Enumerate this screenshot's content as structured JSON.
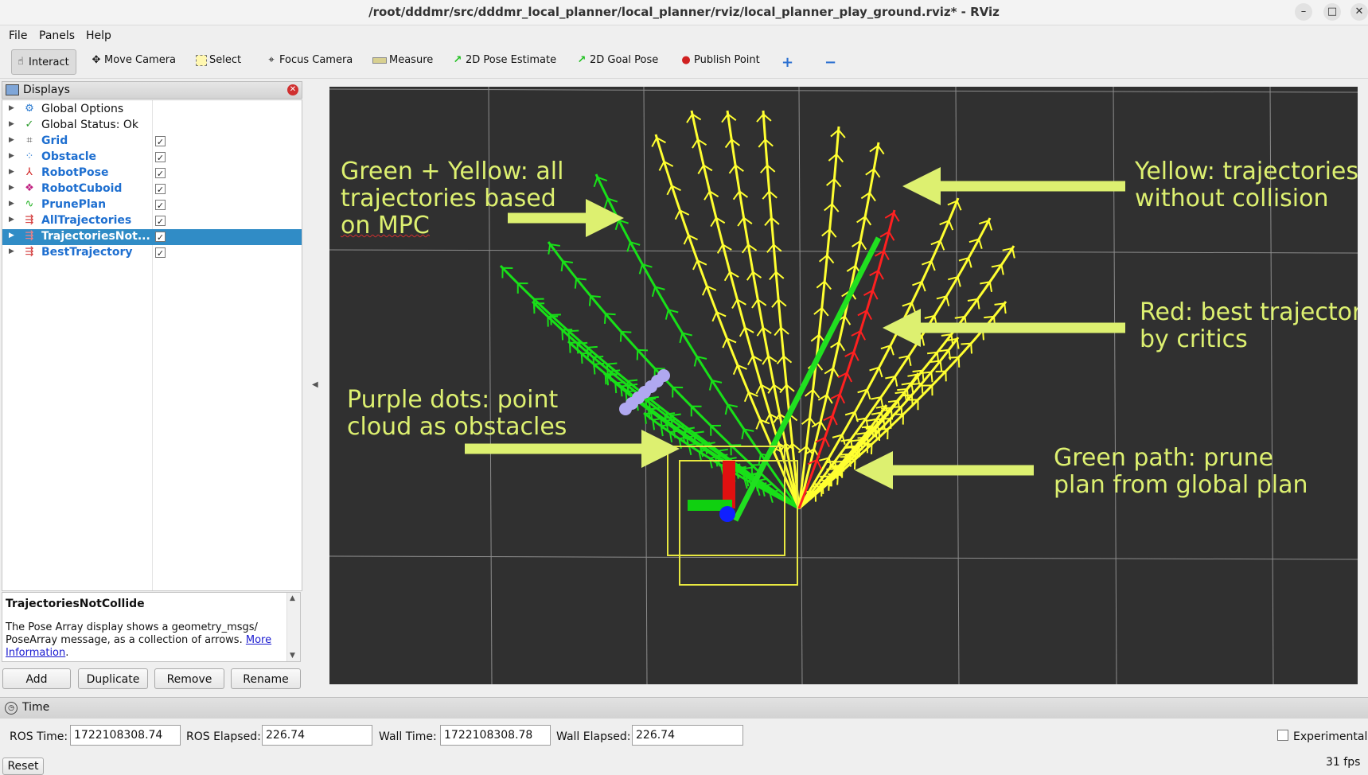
{
  "window": {
    "title": "/root/dddmr/src/dddmr_local_planner/local_planner/rviz/local_planner_play_ground.rviz* - RViz"
  },
  "menu": {
    "file": "File",
    "panels": "Panels",
    "help": "Help"
  },
  "toolbar": {
    "interact": "Interact",
    "move_camera": "Move Camera",
    "select": "Select",
    "focus_camera": "Focus Camera",
    "measure": "Measure",
    "pose_estimate": "2D Pose Estimate",
    "goal_pose": "2D Goal Pose",
    "publish_point": "Publish Point"
  },
  "displays": {
    "title": "Displays",
    "items": [
      {
        "label": "Global Options"
      },
      {
        "label": "Global Status: Ok"
      },
      {
        "label": "Grid",
        "checked": "✓"
      },
      {
        "label": "Obstacle",
        "checked": "✓"
      },
      {
        "label": "RobotPose",
        "checked": "✓"
      },
      {
        "label": "RobotCuboid",
        "checked": "✓"
      },
      {
        "label": "PrunePlan",
        "checked": "✓"
      },
      {
        "label": "AllTrajectories",
        "checked": "✓"
      },
      {
        "label": "TrajectoriesNot...",
        "checked": "✓"
      },
      {
        "label": "BestTrajectory",
        "checked": "✓"
      }
    ]
  },
  "description": {
    "title": "TrajectoriesNotCollide",
    "text": "The Pose Array display shows a geometry_msgs/ PoseArray message, as a collection of arrows.",
    "link_more": "More",
    "link_info": "Information",
    "end": "."
  },
  "buttons": {
    "add": "Add",
    "duplicate": "Duplicate",
    "remove": "Remove",
    "rename": "Rename"
  },
  "annotations": {
    "green_yellow": [
      "Green + Yellow: all",
      "trajectories based",
      "on MPC"
    ],
    "yellow": [
      "Yellow: trajectories",
      "without collision"
    ],
    "red": [
      "Red: best trajectory",
      "by critics"
    ],
    "purple": [
      "Purple dots: point",
      "cloud as obstacles"
    ],
    "green_path": [
      "Green path: prune",
      "plan from global plan"
    ]
  },
  "time": {
    "title": "Time",
    "ros_time_label": "ROS Time:",
    "ros_time": "1722108308.74",
    "ros_elapsed_label": "ROS Elapsed:",
    "ros_elapsed": "226.74",
    "wall_time_label": "Wall Time:",
    "wall_time": "1722108308.78",
    "wall_elapsed_label": "Wall Elapsed:",
    "wall_elapsed": "226.74",
    "experimental": "Experimental",
    "reset": "Reset",
    "fps": "31 fps"
  },
  "colors": {
    "annotation": "#ddf070",
    "viewport_bg": "#303030",
    "selection": "#308cc6"
  }
}
